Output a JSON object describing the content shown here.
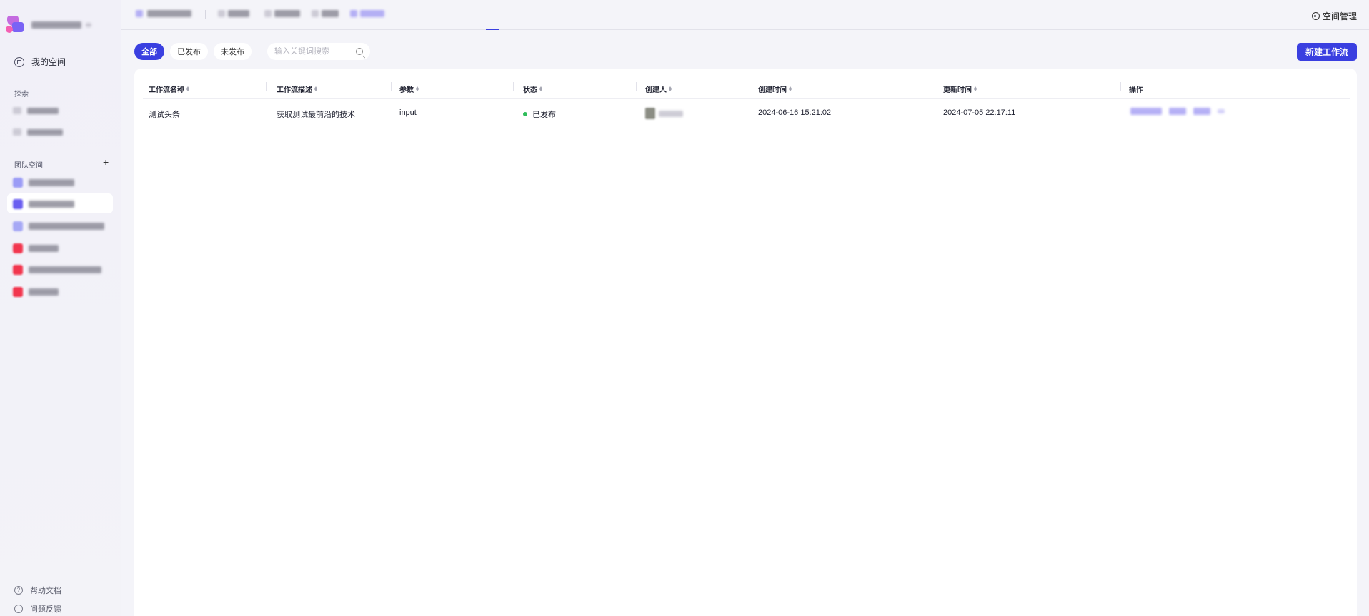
{
  "sidebar": {
    "my_space": "我的空间",
    "explore_title": "探索",
    "team_space_title": "团队空间",
    "add_icon": "+",
    "help_docs": "帮助文档",
    "feedback": "问题反馈"
  },
  "topbar": {
    "space_manage": "空间管理"
  },
  "filters": {
    "all": "全部",
    "published": "已发布",
    "unpublished": "未发布",
    "search_placeholder": "输入关键词搜索"
  },
  "actions": {
    "new_workflow": "新建工作流"
  },
  "table": {
    "columns": [
      "工作流名称",
      "工作流描述",
      "参数",
      "状态",
      "创建人",
      "创建时间",
      "更新时间",
      "操作"
    ],
    "rows": [
      {
        "name": "测试头条",
        "description": "获取测试最前沿的技术",
        "params": "input",
        "status": "已发布",
        "created_at": "2024-06-16 15:21:02",
        "updated_at": "2024-07-05 22:17:11"
      }
    ]
  },
  "colors": {
    "accent": "#3a3fe0",
    "status_published": "#2fbd5a"
  },
  "icons": [
    "brand-logo-icon",
    "my-space-icon",
    "plus-icon",
    "help-icon",
    "feedback-icon",
    "settings-icon",
    "search-icon",
    "sort-icon"
  ]
}
